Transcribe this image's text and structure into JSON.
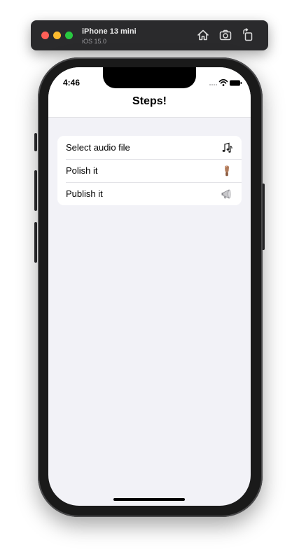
{
  "simulator": {
    "device_name": "iPhone 13 mini",
    "os_version": "iOS 15.0",
    "toolbar_icons": [
      "home-icon",
      "screenshot-icon",
      "rotate-icon"
    ]
  },
  "status_bar": {
    "time": "4:46",
    "icons": [
      "signal-icon",
      "wifi-icon",
      "battery-icon"
    ]
  },
  "nav": {
    "title": "Steps!"
  },
  "steps": [
    {
      "label": "Select audio file",
      "icon": "musical-notes-icon"
    },
    {
      "label": "Polish it",
      "icon": "nail-polish-icon"
    },
    {
      "label": "Publish it",
      "icon": "megaphone-icon"
    }
  ],
  "colors": {
    "background": "#f2f2f7",
    "card": "#ffffff",
    "toolbar": "#2a2a2c",
    "close": "#ff5f57",
    "minimize": "#febc2e",
    "zoom": "#28c840"
  }
}
